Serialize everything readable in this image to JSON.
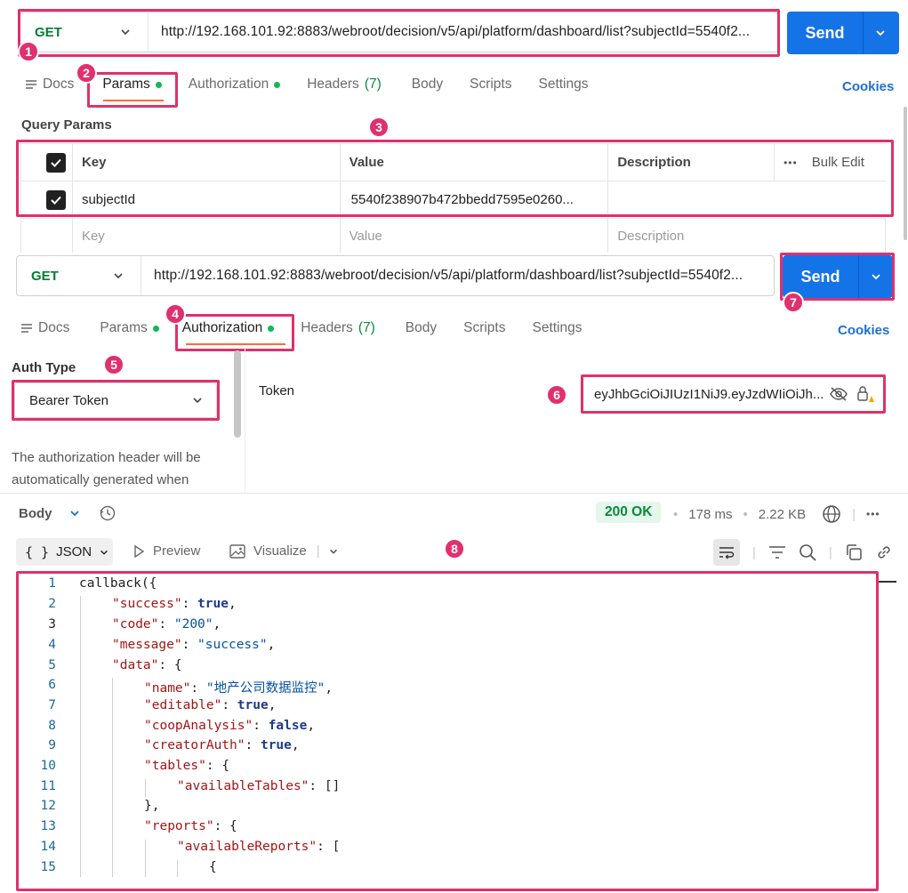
{
  "request1": {
    "method": "GET",
    "url": "http://192.168.101.92:8883/webroot/decision/v5/api/platform/dashboard/list?subjectId=5540f2...",
    "send_label": "Send"
  },
  "tabs1": {
    "docs": "Docs",
    "params": "Params",
    "authorization": "Authorization",
    "headers": "Headers",
    "headers_count": "(7)",
    "body": "Body",
    "scripts": "Scripts",
    "settings": "Settings",
    "cookies": "Cookies"
  },
  "query_params": {
    "title": "Query Params",
    "columns": {
      "key": "Key",
      "value": "Value",
      "description": "Description",
      "bulk_edit": "Bulk Edit"
    },
    "rows": [
      {
        "key": "subjectId",
        "value": "5540f238907b472bbedd7595e0260...",
        "description": ""
      }
    ],
    "placeholder": {
      "key": "Key",
      "value": "Value",
      "description": "Description"
    }
  },
  "request2": {
    "method": "GET",
    "url": "http://192.168.101.92:8883/webroot/decision/v5/api/platform/dashboard/list?subjectId=5540f2...",
    "send_label": "Send"
  },
  "tabs2": {
    "docs": "Docs",
    "params": "Params",
    "authorization": "Authorization",
    "headers": "Headers",
    "headers_count": "(7)",
    "body": "Body",
    "scripts": "Scripts",
    "settings": "Settings",
    "cookies": "Cookies"
  },
  "auth": {
    "type_label": "Auth Type",
    "type_value": "Bearer Token",
    "description": "The authorization header will be automatically generated when",
    "token_label": "Token",
    "token_value": "eyJhbGciOiJIUzI1NiJ9.eyJzdWIiOiJh..."
  },
  "response": {
    "body_label": "Body",
    "status": "200 OK",
    "time": "178 ms",
    "size": "2.22 KB",
    "format": "JSON",
    "preview": "Preview",
    "visualize": "Visualize"
  },
  "code_lines": [
    "1",
    "2",
    "3",
    "4",
    "5",
    "6",
    "7",
    "8",
    "9",
    "10",
    "11",
    "12",
    "13",
    "14",
    "15"
  ],
  "json_text": {
    "callback": "callback({",
    "success_key": "\"success\"",
    "success_val": "true",
    "code_key": "\"code\"",
    "code_val": "\"200\"",
    "message_key": "\"message\"",
    "message_val": "\"success\"",
    "data_key": "\"data\"",
    "name_key": "\"name\"",
    "name_val": "\"地产公司数据监控\"",
    "editable_key": "\"editable\"",
    "editable_val": "true",
    "coop_key": "\"coopAnalysis\"",
    "coop_val": "false",
    "creator_key": "\"creatorAuth\"",
    "creator_val": "true",
    "tables_key": "\"tables\"",
    "avail_tables_key": "\"availableTables\"",
    "avail_tables_val": "[]",
    "reports_key": "\"reports\"",
    "avail_reports_key": "\"availableReports\"",
    "open_brace": "{",
    "close_brace_comma": "},",
    "open_bracket": "["
  },
  "markers": [
    "1",
    "2",
    "3",
    "4",
    "5",
    "6",
    "7",
    "8"
  ],
  "colors": {
    "highlight": "#e0306e",
    "accent": "#1473e6",
    "green": "#0cbb52",
    "orange": "#ff6c37"
  }
}
